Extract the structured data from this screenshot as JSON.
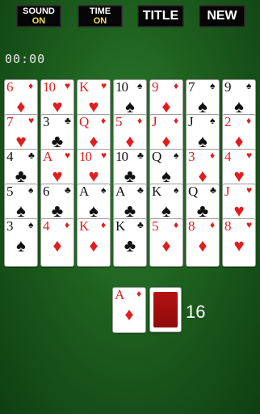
{
  "toolbar": {
    "sound": {
      "label": "SOUND",
      "state": "ON"
    },
    "time": {
      "label": "TIME",
      "state": "ON"
    },
    "title_label": "TITLE",
    "new_label": "NEW"
  },
  "timer": "00:00",
  "tableau": [
    [
      {
        "rank": "6",
        "suit": "diamonds"
      },
      {
        "rank": "7",
        "suit": "hearts"
      },
      {
        "rank": "4",
        "suit": "clubs"
      },
      {
        "rank": "5",
        "suit": "spades"
      },
      {
        "rank": "3",
        "suit": "spades"
      }
    ],
    [
      {
        "rank": "10",
        "suit": "hearts"
      },
      {
        "rank": "3",
        "suit": "clubs"
      },
      {
        "rank": "A",
        "suit": "hearts"
      },
      {
        "rank": "6",
        "suit": "clubs"
      },
      {
        "rank": "4",
        "suit": "diamonds"
      }
    ],
    [
      {
        "rank": "K",
        "suit": "hearts"
      },
      {
        "rank": "Q",
        "suit": "diamonds"
      },
      {
        "rank": "10",
        "suit": "hearts"
      },
      {
        "rank": "A",
        "suit": "spades"
      },
      {
        "rank": "K",
        "suit": "diamonds"
      }
    ],
    [
      {
        "rank": "10",
        "suit": "spades"
      },
      {
        "rank": "5",
        "suit": "diamonds"
      },
      {
        "rank": "10",
        "suit": "clubs"
      },
      {
        "rank": "A",
        "suit": "clubs"
      },
      {
        "rank": "K",
        "suit": "clubs"
      }
    ],
    [
      {
        "rank": "9",
        "suit": "diamonds"
      },
      {
        "rank": "J",
        "suit": "diamonds"
      },
      {
        "rank": "Q",
        "suit": "spades"
      },
      {
        "rank": "K",
        "suit": "spades"
      },
      {
        "rank": "5",
        "suit": "diamonds"
      }
    ],
    [
      {
        "rank": "7",
        "suit": "spades"
      },
      {
        "rank": "J",
        "suit": "spades"
      },
      {
        "rank": "3",
        "suit": "diamonds"
      },
      {
        "rank": "Q",
        "suit": "clubs"
      },
      {
        "rank": "8",
        "suit": "diamonds"
      }
    ],
    [
      {
        "rank": "9",
        "suit": "spades"
      },
      {
        "rank": "2",
        "suit": "diamonds"
      },
      {
        "rank": "4",
        "suit": "hearts"
      },
      {
        "rank": "J",
        "suit": "hearts"
      },
      {
        "rank": "8",
        "suit": "hearts"
      }
    ]
  ],
  "waste_card": {
    "rank": "A",
    "suit": "diamonds"
  },
  "stock_count": "16",
  "colors": {
    "felt": "#1d5f1e",
    "card_red": "#e01e1e",
    "card_back": "#a50f0f",
    "toggle_on": "#f1e24a"
  }
}
